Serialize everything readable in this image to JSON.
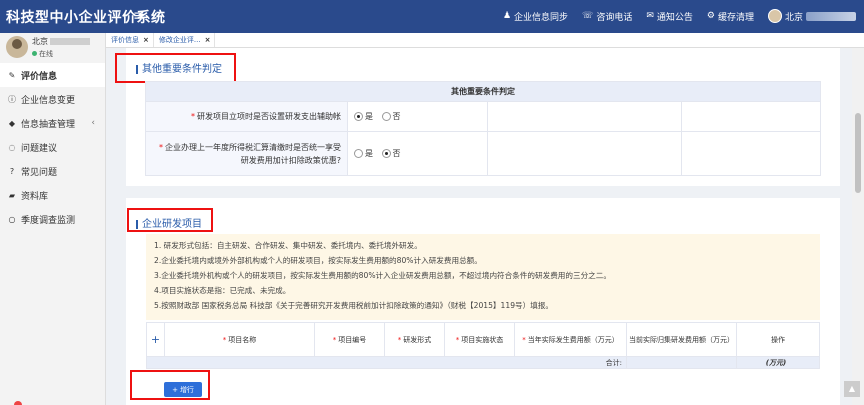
{
  "app": {
    "title": "科技型中小企业评价系统",
    "menu_icon": "hamburger-icon"
  },
  "topnav": [
    {
      "icon": "user-icon",
      "label": "企业信息同步"
    },
    {
      "icon": "phone-icon",
      "label": "咨询电话"
    },
    {
      "icon": "envelope-icon",
      "label": "通知公告"
    },
    {
      "icon": "gear-icon",
      "label": "缓存清理"
    }
  ],
  "user": {
    "top_name": "北京",
    "side_name": "北京",
    "status": "在线"
  },
  "sidebar": [
    {
      "icon": "edit-icon",
      "label": "评价信息",
      "active": true
    },
    {
      "icon": "info-icon",
      "label": "企业信息变更"
    },
    {
      "icon": "tag-icon",
      "label": "信息抽查管理",
      "chevron": "‹"
    },
    {
      "icon": "comment-icon",
      "label": "问题建议"
    },
    {
      "icon": "question-icon",
      "label": "常见问题"
    },
    {
      "icon": "folder-icon",
      "label": "资料库"
    },
    {
      "icon": "circle-icon",
      "label": "季度调查监测"
    }
  ],
  "tabs": [
    {
      "label": "评价信息",
      "close": "×"
    },
    {
      "label": "修改企业评...",
      "close": "×"
    }
  ],
  "section1": {
    "title": "其他重要条件判定",
    "table_header": "其他重要条件判定",
    "rows": [
      {
        "question": "研发项目立项时是否设置研发支出辅助帐",
        "yes": "是",
        "no": "否",
        "selected": "yes"
      },
      {
        "question": "企业办理上一年度所得税汇算清缴时是否统一享受研发费用加计扣除政策优惠?",
        "yes": "是",
        "no": "否",
        "selected": "no"
      }
    ]
  },
  "section2": {
    "title": "企业研发项目",
    "notes": [
      "1. 研发形式包括：自主研发、合作研发、集中研发、委托境内、委托境外研发。",
      "2.企业委托境内或境外外部机构或个人的研发项目，按实际发生费用额的80%计入研发费用总额。",
      "3.企业委托境外机构或个人的研发项目，按实际发生费用额的80%计入企业研发费用总额，不超过境内符合条件的研发费用的三分之二。",
      "4.项目实施状态是指：已完成、未完成。",
      "5.按照财政部 国家税务总局 科技部《关于完善研究开发费用税前加计扣除政策的通知》（财税【2015】119号）填报。"
    ],
    "table": {
      "add_symbol": "+",
      "columns": [
        "项目名称",
        "项目编号",
        "研发形式",
        "项目实施状态",
        "当年实际发生费用额（万元）",
        "当前实际归集研发费用额（万元）",
        "操作"
      ],
      "required": [
        true,
        true,
        true,
        true,
        true,
        false,
        false
      ],
      "total_label": "合计:",
      "unit_label": "(万元)"
    },
    "add_row_label": "增行"
  },
  "scroll_top_icon": "▲"
}
